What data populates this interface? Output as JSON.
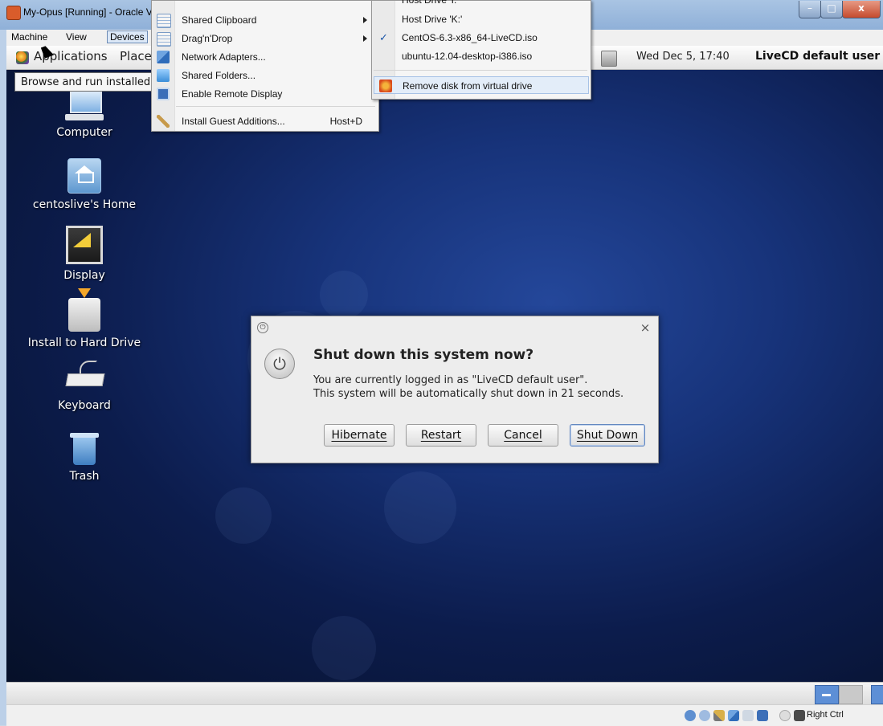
{
  "vbox_window": {
    "title": "My-Opus [Running] - Oracle VM VirtualBox",
    "menubar": [
      "Machine",
      "View",
      "Devices"
    ],
    "active_menu": "Devices",
    "host_key_label": "Right Ctrl",
    "title_buttons": {
      "minimize": "–",
      "maximize": "□",
      "close": "x"
    }
  },
  "devices_menu": {
    "items": [
      {
        "label": "Shared Clipboard",
        "icon": "clipboard-icon",
        "submenu": true
      },
      {
        "label": "Drag'n'Drop",
        "icon": "dragdrop-icon",
        "submenu": true
      },
      {
        "label": "Network Adapters...",
        "icon": "network-adapters-icon"
      },
      {
        "label": "Shared Folders...",
        "icon": "shared-folders-icon"
      },
      {
        "label": "Enable Remote Display",
        "icon": "remote-display-icon"
      },
      {
        "label": "Install Guest Additions...",
        "icon": "guest-additions-icon",
        "shortcut": "Host+D"
      }
    ]
  },
  "cd_submenu": {
    "items": [
      {
        "label": "Host Drive 'I:'",
        "checked": false
      },
      {
        "label": "Host Drive 'K:'",
        "checked": false
      },
      {
        "label": "CentOS-6.3-x86_64-LiveCD.iso",
        "checked": true
      },
      {
        "label": "ubuntu-12.04-desktop-i386.iso",
        "checked": false
      }
    ],
    "remove_label": "Remove disk from virtual drive"
  },
  "guest_panel": {
    "applications": "Applications",
    "places": "Places",
    "clock": "Wed Dec  5, 17:40",
    "user": "LiveCD default user"
  },
  "tooltip": "Browse and run installed applications",
  "desktop_icons": [
    {
      "label": "Computer",
      "icon": "computer-icon"
    },
    {
      "label": "centoslive's Home",
      "icon": "home-folder-icon"
    },
    {
      "label": "Display",
      "icon": "display-icon"
    },
    {
      "label": "Install to Hard Drive",
      "icon": "install-hdd-icon"
    },
    {
      "label": "Keyboard",
      "icon": "keyboard-icon"
    },
    {
      "label": "Trash",
      "icon": "trash-icon"
    }
  ],
  "dialog": {
    "title": "Shut down this system now?",
    "message_line1": "You are currently logged in as \"LiveCD default user\".",
    "message_line2": "This system will be automatically shut down in 21 seconds.",
    "close_glyph": "×",
    "buttons": {
      "hibernate": "Hibernate",
      "restart": "Restart",
      "cancel": "Cancel",
      "shut_down": "Shut Down"
    }
  },
  "colors": {
    "desktop_bg": "#0c1c4c",
    "menu_highlight": "#e3edf9",
    "accent": "#3a7bd5"
  }
}
